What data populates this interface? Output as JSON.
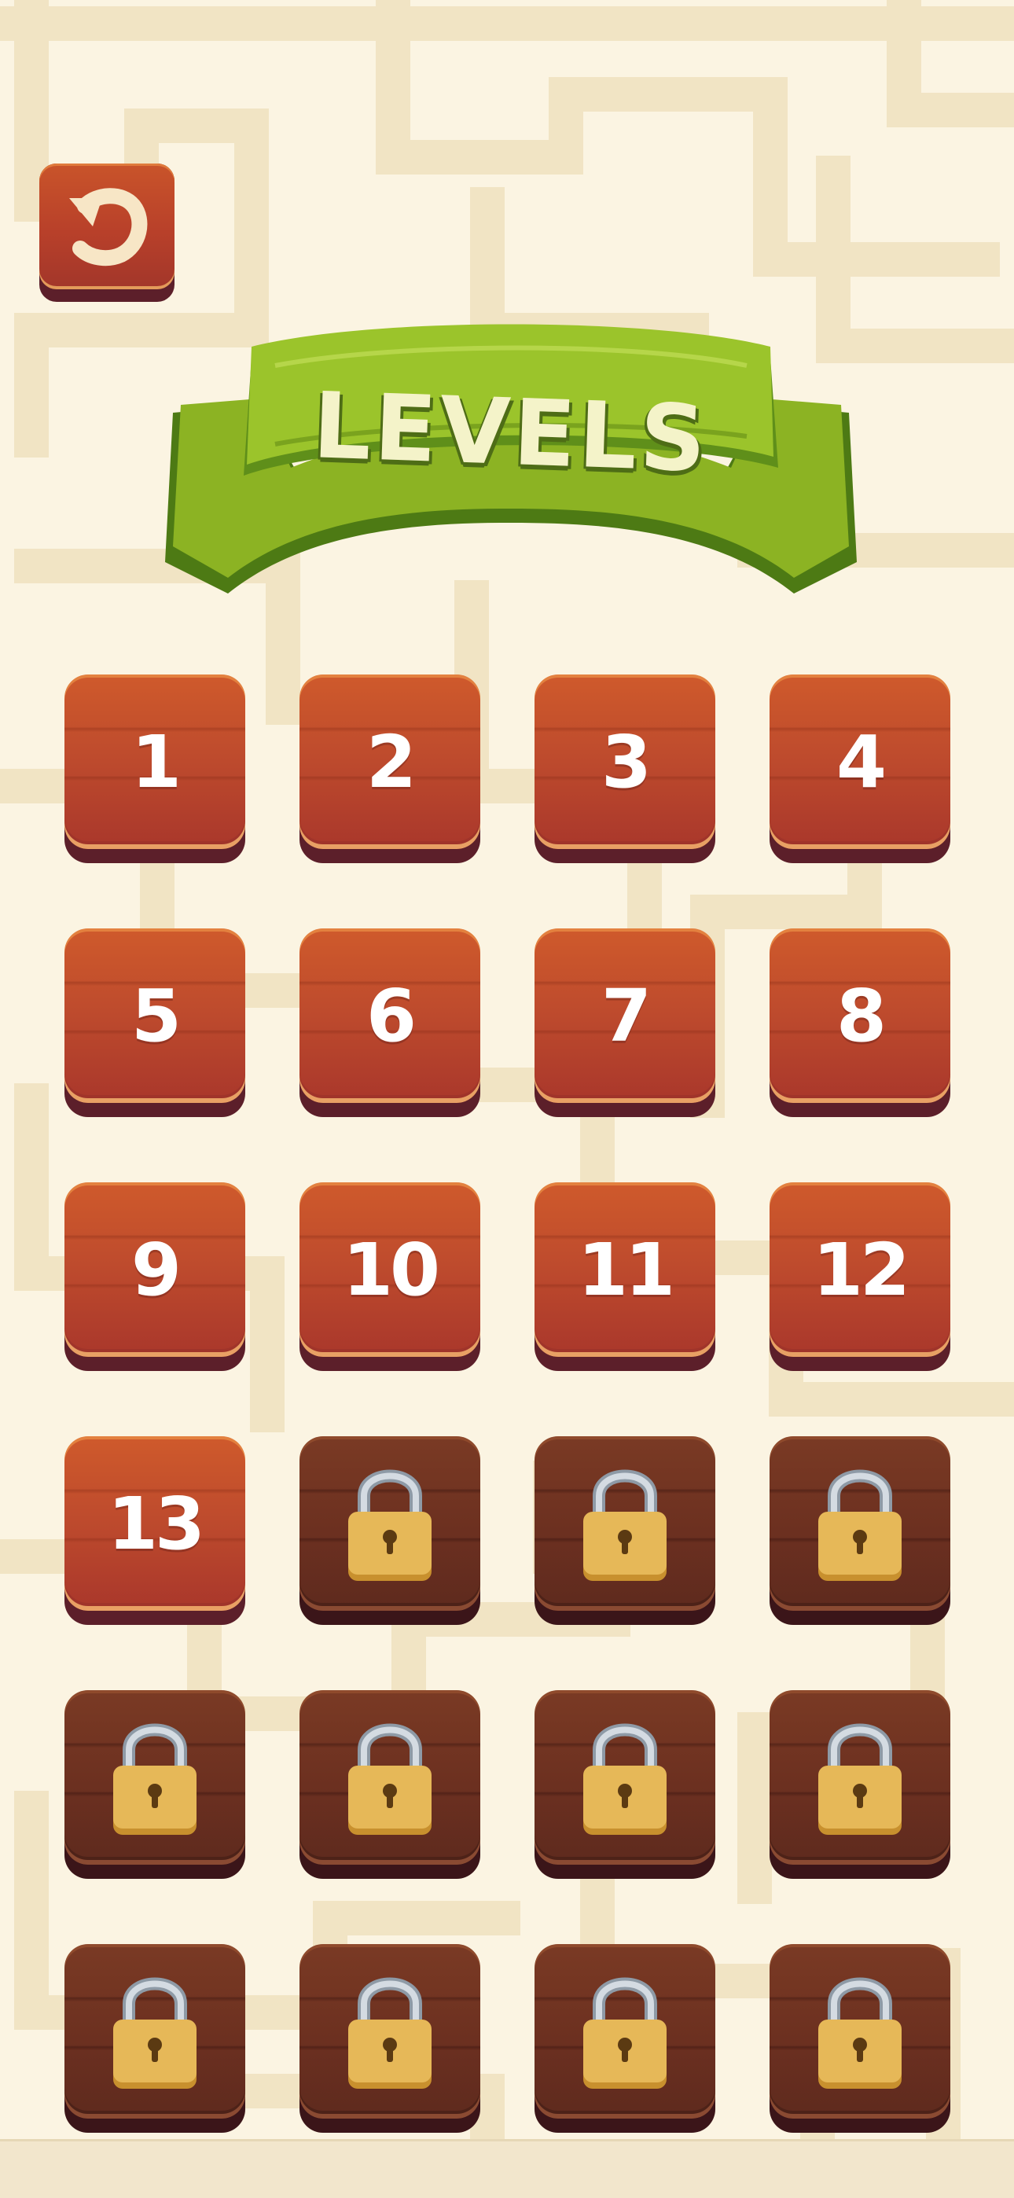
{
  "screen": {
    "title": "LEVELS",
    "colors": {
      "background": "#fbf4e2",
      "maze_path": "#f0e4c6",
      "banner_green": "#8cb323",
      "tile_unlocked": "#c04b2c",
      "tile_locked": "#6c3020",
      "lock_gold": "#e2b14c"
    }
  },
  "back_button": {
    "icon": "back-arrow-icon"
  },
  "levels": [
    {
      "label": "1",
      "locked": false
    },
    {
      "label": "2",
      "locked": false
    },
    {
      "label": "3",
      "locked": false
    },
    {
      "label": "4",
      "locked": false
    },
    {
      "label": "5",
      "locked": false
    },
    {
      "label": "6",
      "locked": false
    },
    {
      "label": "7",
      "locked": false
    },
    {
      "label": "8",
      "locked": false
    },
    {
      "label": "9",
      "locked": false
    },
    {
      "label": "10",
      "locked": false
    },
    {
      "label": "11",
      "locked": false
    },
    {
      "label": "12",
      "locked": false
    },
    {
      "label": "13",
      "locked": false
    },
    {
      "label": "",
      "locked": true
    },
    {
      "label": "",
      "locked": true
    },
    {
      "label": "",
      "locked": true
    },
    {
      "label": "",
      "locked": true
    },
    {
      "label": "",
      "locked": true
    },
    {
      "label": "",
      "locked": true
    },
    {
      "label": "",
      "locked": true
    },
    {
      "label": "",
      "locked": true
    },
    {
      "label": "",
      "locked": true
    },
    {
      "label": "",
      "locked": true
    },
    {
      "label": "",
      "locked": true
    }
  ]
}
